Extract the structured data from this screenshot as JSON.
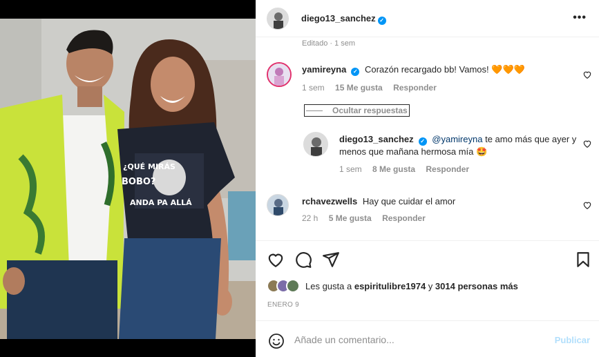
{
  "post": {
    "author": "diego13_sanchez",
    "more_label": "•••",
    "edited_label": "Editado · 1 sem"
  },
  "comments": [
    {
      "user": "yamireyna",
      "text": "Corazón recargado bb! Vamos! 🧡🧡🧡",
      "time": "1 sem",
      "likes": "15 Me gusta",
      "reply": "Responder"
    },
    {
      "user": "diego13_sanchez",
      "mention": "@yamireyna",
      "text": "te amo más que ayer y menos que mañana hermosa mía 🤩",
      "time": "1 sem",
      "likes": "8 Me gusta",
      "reply": "Responder"
    },
    {
      "user": "rchavezwells",
      "text": "Hay que cuidar el amor",
      "time": "22 h",
      "likes": "5 Me gusta",
      "reply": "Responder"
    }
  ],
  "toggle_replies_label": "Ocultar respuestas",
  "likes_summary": {
    "prefix": "Les gusta a",
    "user": "espiritulibre1974",
    "middle": "y",
    "others": "3014 personas más"
  },
  "date": "ENERO 9",
  "comment_box": {
    "placeholder": "Añade un comentario...",
    "publish_label": "Publicar"
  },
  "colors": {
    "verified": "#0095f6",
    "publish_disabled": "#b2dffc",
    "muted": "#8e8e8e"
  },
  "photo": {
    "shirt_text_1": "¿QUÉ MIRÁS",
    "shirt_text_2": "BOBO?",
    "shirt_text_3": "ANDA PA ALLÁ"
  }
}
